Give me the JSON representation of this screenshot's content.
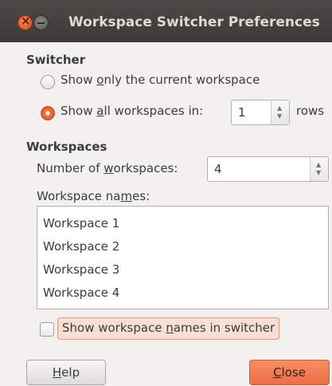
{
  "window": {
    "title": "Workspace Switcher Preferences"
  },
  "switcher": {
    "heading": "Switcher",
    "option_current_pre": "Show ",
    "option_current_key": "o",
    "option_current_post": "nly the current workspace",
    "option_all_pre": "Show ",
    "option_all_key": "a",
    "option_all_post": "ll workspaces in:",
    "option_all_selected": true,
    "rows_value": "1",
    "rows_suffix": "rows"
  },
  "workspaces": {
    "heading": "Workspaces",
    "count_label_pre": "Number of ",
    "count_label_key": "w",
    "count_label_post": "orkspaces:",
    "count_value": "4",
    "names_label_pre": "Workspace na",
    "names_label_key": "m",
    "names_label_post": "es:",
    "names": [
      "Workspace 1",
      "Workspace 2",
      "Workspace 3",
      "Workspace 4"
    ],
    "show_names_pre": "Show workspace ",
    "show_names_key": "n",
    "show_names_post": "ames in switcher",
    "show_names_checked": false
  },
  "buttons": {
    "help_key": "H",
    "help_rest": "elp",
    "close_key": "C",
    "close_rest": "lose"
  }
}
